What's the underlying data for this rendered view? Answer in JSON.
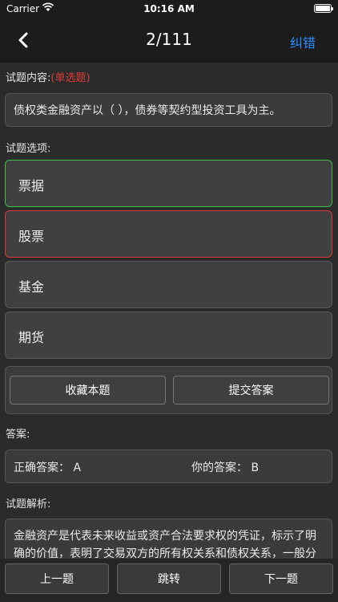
{
  "status": {
    "carrier": "Carrier",
    "time": "10:16 AM"
  },
  "nav": {
    "counter": "2/111",
    "report": "纠错"
  },
  "question": {
    "label": "试题内容:",
    "type": "(单选题)",
    "text": "债权类金融资产以（        ），债券等契约型投资工具为主。"
  },
  "options_label": "试题选项:",
  "options": [
    {
      "text": "票据",
      "state": "correct"
    },
    {
      "text": "股票",
      "state": "wrong"
    },
    {
      "text": "基金",
      "state": "normal"
    },
    {
      "text": "期货",
      "state": "normal"
    }
  ],
  "actions": {
    "favorite": "收藏本题",
    "submit": "提交答案"
  },
  "answer": {
    "label": "答案:",
    "correct_label": "正确答案：",
    "correct_value": "A",
    "yours_label": "你的答案：",
    "yours_value": "B"
  },
  "analysis": {
    "label": "试题解析:",
    "text": "金融资产是代表未来收益或资产合法要求权的凭证，标示了明确的价值，表明了交易双方的所有权关系和债权关系，一般分"
  },
  "bottom": {
    "prev": "上一题",
    "jump": "跳转",
    "next": "下一题"
  },
  "colors": {
    "accent": "#2f8cff",
    "correct": "#3fbf4a",
    "wrong": "#d83a3a",
    "tag": "#e03a3a"
  }
}
